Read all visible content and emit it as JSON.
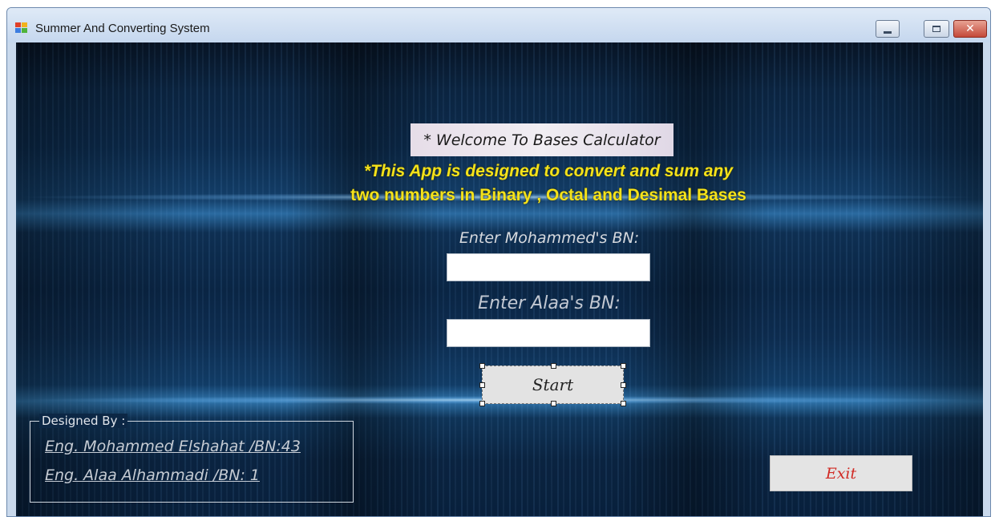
{
  "window": {
    "title": "Summer And Converting System",
    "controls": {
      "minimize_icon": "minimize-icon",
      "maximize_icon": "maximize-icon",
      "close_icon": "close-icon"
    }
  },
  "main": {
    "welcome_text": "* Welcome To Bases Calculator",
    "description_line1": "*This App is designed to convert and sum any",
    "description_line2": "two numbers in Binary , Octal and Desimal Bases",
    "mohammed_label": "Enter Mohammed's BN:",
    "mohammed_value": "",
    "alaa_label": "Enter Alaa's BN:",
    "alaa_value": "",
    "start_label": "Start",
    "exit_label": "Exit"
  },
  "credits": {
    "group_title": "Designed By :",
    "line1": "Eng. Mohammed Elshahat /BN:43",
    "line2": "Eng. Alaa Alhammadi  /BN: 1"
  },
  "colors": {
    "description_text": "#f5e21a",
    "exit_text": "#d12a24",
    "background_dark": "#0a2544",
    "background_glow": "#2f74ab"
  }
}
